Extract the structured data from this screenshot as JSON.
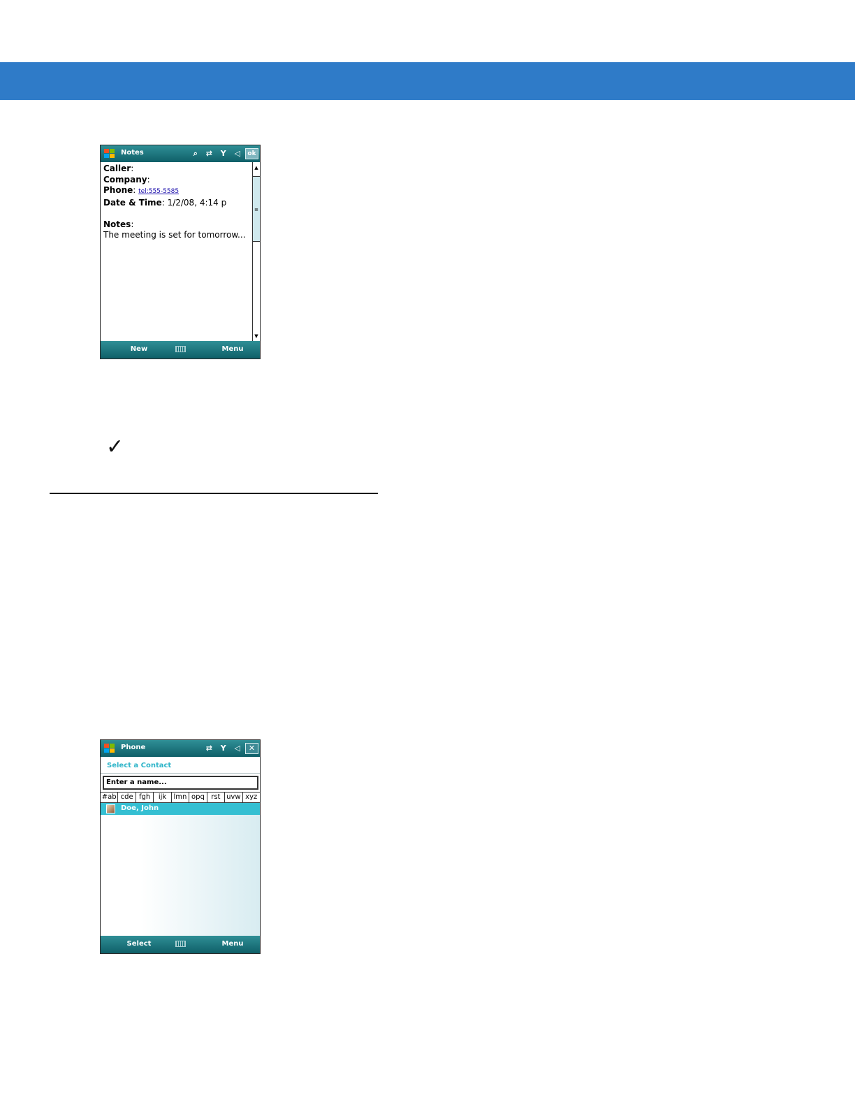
{
  "notes_screen": {
    "title": "Notes",
    "status_icons": "⌕ ⇄ Y ◁",
    "ok_label": "ok",
    "fields": [
      {
        "label": "Caller",
        "value": ""
      },
      {
        "label": "Company",
        "value": ""
      },
      {
        "label": "Phone",
        "value": "tel:555-5585"
      },
      {
        "label": "Date & Time",
        "value": "1/2/08, 4:14 p"
      }
    ],
    "notes_label": "Notes",
    "notes_text": "The meeting is set for tomorrow...",
    "softkey_left": "New",
    "softkey_right": "Menu"
  },
  "phone_screen": {
    "title": "Phone",
    "status_icons": "⇄ Y ◁",
    "close_label": "✕",
    "heading": "Select a Contact",
    "input_value": "Enter a name...",
    "letter_groups": [
      "#ab",
      "cde",
      "fgh",
      "ijk",
      "lmn",
      "opq",
      "rst",
      "uvw",
      "xyz"
    ],
    "contacts": [
      {
        "name": "Doe, John"
      }
    ],
    "softkey_left": "Select",
    "softkey_right": "Menu"
  },
  "colors": {
    "banner": "#2f7bc8",
    "title_bar": "#0f5f68",
    "accent": "#35bfd2"
  }
}
